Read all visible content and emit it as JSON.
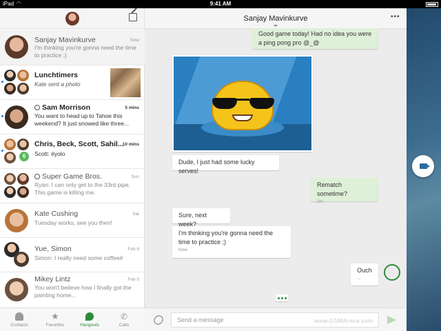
{
  "status_bar": {
    "carrier": "iPad",
    "time": "9:41 AM"
  },
  "sidebar": {
    "conversations": [
      {
        "name": "Sanjay Mavinkurve",
        "time": "Now",
        "snippet": "I'm thinking you're gonna need the time to practice ;)",
        "unread": false
      },
      {
        "name": "Lunchtimers",
        "time": "",
        "snippet": "Kate sent a photo",
        "unread": true
      },
      {
        "name": "Sam Morrison",
        "time": "5 mins",
        "snippet": "You want to head up to Tahoe this weekend? It just snowed like three...",
        "unread": true
      },
      {
        "name": "Chris, Beck, Scott, Sahil...",
        "time": "10 mins",
        "snippet": "Scott: #yolo",
        "unread": true,
        "badge": "6"
      },
      {
        "name": "Super Game Bros.",
        "time": "Sun",
        "snippet": "Ryan: I can only get to the 33rd pipe. This game is killing me.",
        "unread": false
      },
      {
        "name": "Kate Cushing",
        "time": "Sat",
        "snippet": "Tuesday works, see you then!",
        "unread": false
      },
      {
        "name": "Yue, Simon",
        "time": "Feb 8",
        "snippet": "Simon: I really need some coffee#",
        "unread": false
      },
      {
        "name": "Mikey Lintz",
        "time": "Feb 5",
        "snippet": "You won't believe how I finally got the painting home...",
        "unread": false
      }
    ]
  },
  "tabs": [
    {
      "label": "Contacts",
      "icon": "contacts-icon",
      "active": false
    },
    {
      "label": "Favorites",
      "icon": "star-icon",
      "active": false
    },
    {
      "label": "Hangouts",
      "icon": "hangouts-icon",
      "active": true
    },
    {
      "label": "Calls",
      "icon": "phone-icon",
      "active": false
    }
  ],
  "chat": {
    "title": "Sanjay Mavinkurve",
    "more_label": "•••",
    "messages": [
      {
        "dir": "out",
        "text": "Good game today! Had no idea you were a ping pong pro @_@"
      },
      {
        "dir": "in",
        "type": "sticker",
        "sticker": "sunglasses-emoji-sticker"
      },
      {
        "dir": "in",
        "text": "Dude, I just had some lucky serves!"
      },
      {
        "dir": "out",
        "text": "Rematch sometime?",
        "meta": "2m"
      },
      {
        "dir": "in",
        "text": "Sure, next week?"
      },
      {
        "dir": "in",
        "text": "I'm thinking you're gonna need the time to practice ;)",
        "meta": "Now"
      },
      {
        "dir": "out",
        "text": "Ouch",
        "meta": "..."
      }
    ],
    "input_placeholder": "Send a message",
    "watermark": "www.GSMArena.com"
  },
  "colors": {
    "accent": "#2e8b3a",
    "outgoing_bubble": "#dff0d8",
    "unread_dot": "#2c7bd6"
  }
}
